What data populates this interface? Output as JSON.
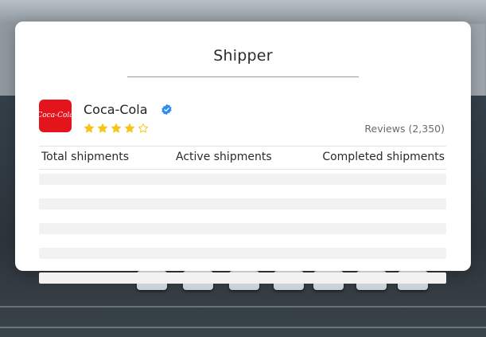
{
  "card": {
    "title": "Shipper",
    "company": {
      "name": "Coca-Cola",
      "logo_text": "Coca-Cola",
      "verified_icon": "verified-badge-icon",
      "rating_stars": 4,
      "rating_max": 5,
      "reviews_label": "Reviews (2,350)"
    },
    "table": {
      "headers": [
        "Total shipments",
        "Active shipments",
        "Completed shipments"
      ],
      "placeholder_rows": 5
    }
  },
  "colors": {
    "brand_red": "#e3141c",
    "star": "#f5c518",
    "verified": "#2d8cf0"
  }
}
